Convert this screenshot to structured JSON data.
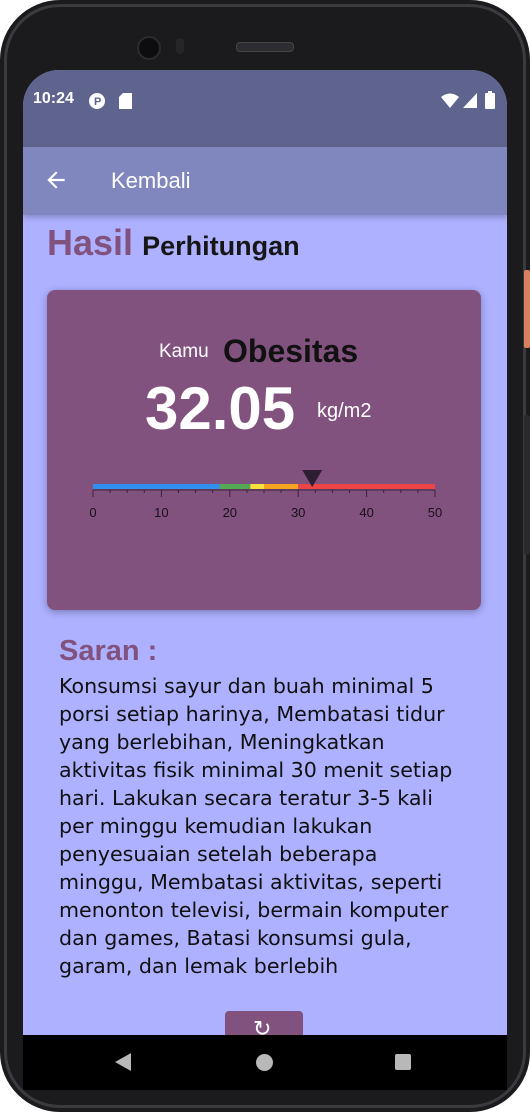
{
  "status_bar": {
    "time": "10:24"
  },
  "app_bar": {
    "back_label": "Kembali"
  },
  "heading": {
    "part1": "Hasil",
    "part2": "Perhitungan"
  },
  "result": {
    "prefix": "Kamu",
    "category": "Obesitas",
    "bmi_value": "32.05",
    "unit": "kg/m2"
  },
  "gauge": {
    "min": 0,
    "max": 50,
    "value": 32.05,
    "ticks": [
      "0",
      "10",
      "20",
      "30",
      "40",
      "50"
    ],
    "segments": [
      {
        "from": 0,
        "to": 18.5,
        "color": "#2f90ee"
      },
      {
        "from": 18.5,
        "to": 23,
        "color": "#55a855"
      },
      {
        "from": 23,
        "to": 25,
        "color": "#f6e43c"
      },
      {
        "from": 25,
        "to": 30,
        "color": "#f5a422"
      },
      {
        "from": 30,
        "to": 50,
        "color": "#ec4545"
      }
    ]
  },
  "saran": {
    "title": "Saran :",
    "lines": [
      "Konsumsi sayur dan buah minimal 5",
      "porsi setiap harinya, Membatasi tidur",
      "yang berlebihan, Meningkatkan",
      "aktivitas fisik minimal 30 menit setiap",
      "hari. Lakukan secara teratur 3-5 kali",
      "per minggu kemudian lakukan",
      "penyesuaian setelah beberapa",
      "minggu, Membatasi aktivitas, seperti",
      "menonton televisi, bermain komputer",
      "dan games, Batasi konsumsi gula,",
      "garam, dan lemak berlebih"
    ]
  },
  "reset_button": {
    "icon": "refresh-icon",
    "glyph": "↻"
  },
  "colors": {
    "accent": "#82527f",
    "background": "#adb1ff",
    "app_bar": "#8087bf",
    "status_bar": "#5f648e"
  }
}
